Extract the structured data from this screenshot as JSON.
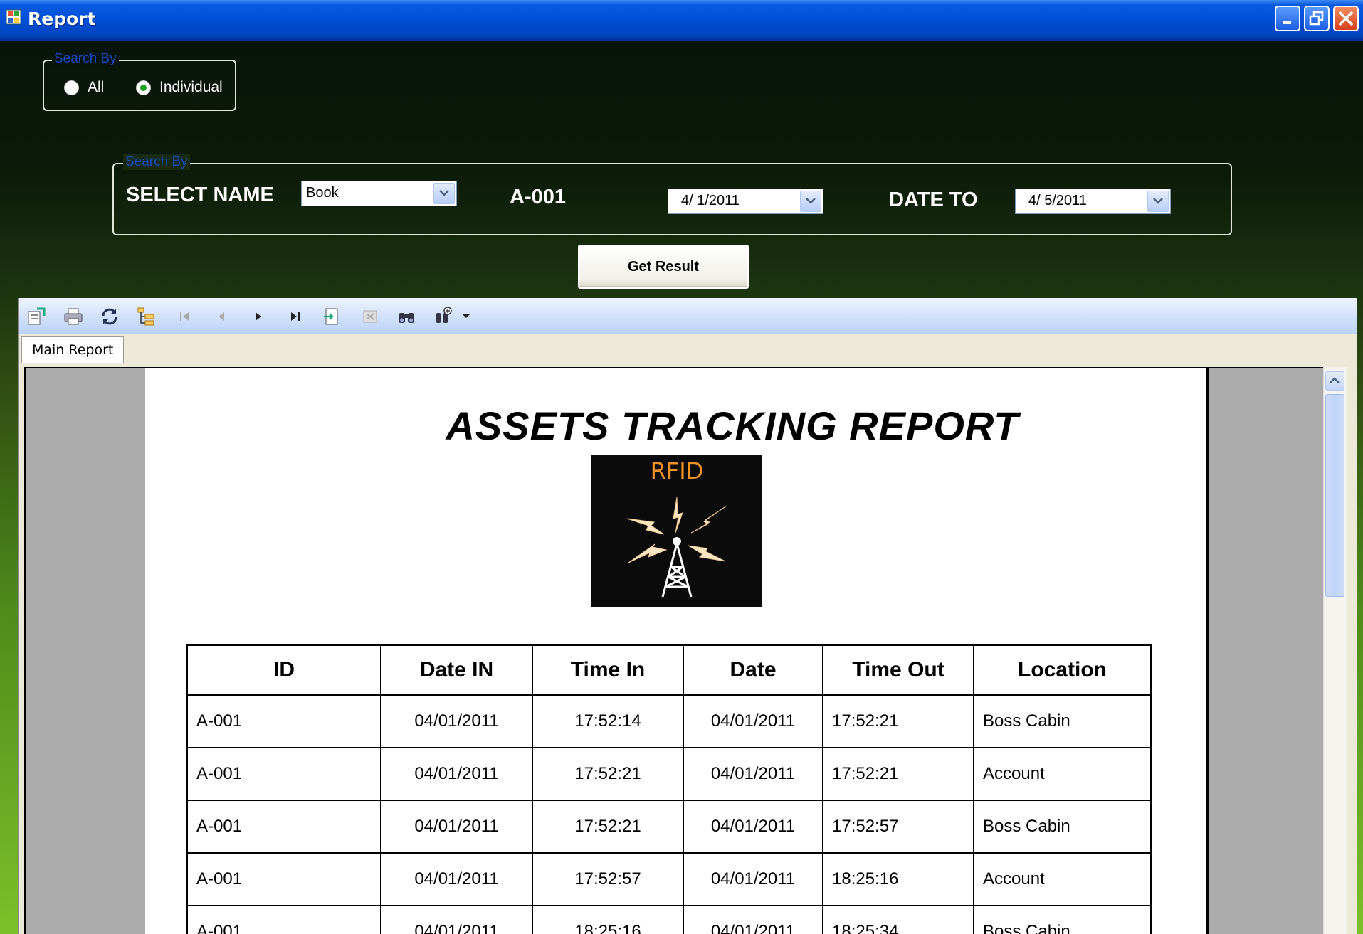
{
  "window": {
    "title": "Report"
  },
  "search_group_1": {
    "legend": "Search By",
    "options": [
      {
        "label": "All",
        "checked": false
      },
      {
        "label": "Individual",
        "checked": true
      }
    ]
  },
  "search_group_2": {
    "legend": "Search By",
    "select_name_label": "SELECT NAME",
    "name_value": "Book",
    "asset_id": "A-001",
    "date_from": "4/ 1/2011",
    "date_to_label": "DATE TO",
    "date_to": "4/ 5/2011"
  },
  "get_result_label": "Get Result",
  "viewer": {
    "toolbar_icons": [
      "export-icon",
      "print-icon",
      "refresh-icon",
      "group-tree-icon",
      "first-page-icon",
      "previous-page-icon",
      "next-page-icon",
      "last-page-icon",
      "goto-page-icon",
      "stop-icon",
      "search-text-icon",
      "zoom-icon"
    ],
    "tab_label": "Main Report"
  },
  "report": {
    "title": "ASSETS TRACKING REPORT",
    "logo_text": "RFID",
    "columns": [
      "ID",
      "Date IN",
      "Time In",
      "Date",
      "Time Out",
      "Location"
    ],
    "rows": [
      [
        "A-001",
        "04/01/2011",
        "17:52:14",
        "04/01/2011",
        "17:52:21",
        "Boss Cabin"
      ],
      [
        "A-001",
        "04/01/2011",
        "17:52:21",
        "04/01/2011",
        "17:52:21",
        "Account"
      ],
      [
        "A-001",
        "04/01/2011",
        "17:52:21",
        "04/01/2011",
        "17:52:57",
        "Boss Cabin"
      ],
      [
        "A-001",
        "04/01/2011",
        "17:52:57",
        "04/01/2011",
        "18:25:16",
        "Account"
      ],
      [
        "A-001",
        "04/01/2011",
        "18:25:16",
        "04/01/2011",
        "18:25:34",
        "Boss Cabin"
      ]
    ]
  },
  "colors": {
    "titlebar": "#0050d8",
    "legend_text": "#1a49c9",
    "logo_text": "#f39224"
  }
}
